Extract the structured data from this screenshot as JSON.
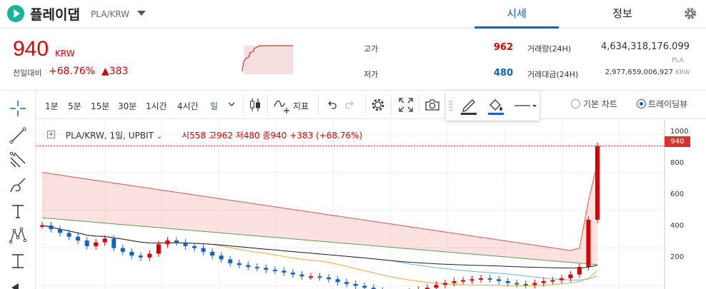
{
  "header": {
    "coin_name": "플레이댑",
    "pair": "PLA/KRW",
    "tabs": [
      {
        "label": "시세",
        "active": true
      },
      {
        "label": "정보",
        "active": false
      }
    ]
  },
  "price": {
    "value": "940",
    "unit": "KRW",
    "change_label": "전일대비",
    "change_pct": "+68.76%",
    "change_abs": "▲383"
  },
  "stats": {
    "high_label": "고가",
    "high_value": "962",
    "low_label": "저가",
    "low_value": "480",
    "volume_label": "거래량(24H)",
    "volume_value": "4,634,318,176.099",
    "volume_unit": "PLA",
    "amount_label": "거래대금(24H)",
    "amount_value": "2,977,659,006,927",
    "amount_unit": "KRW"
  },
  "toolbar": {
    "intervals": [
      {
        "label": "1분",
        "active": false
      },
      {
        "label": "5분",
        "active": false
      },
      {
        "label": "15분",
        "active": false
      },
      {
        "label": "30분",
        "active": false
      },
      {
        "label": "1시간",
        "active": false
      },
      {
        "label": "4시간",
        "active": false
      },
      {
        "label": "일",
        "active": true
      }
    ],
    "indicator_label": "지표",
    "chart_modes": [
      {
        "label": "기본 차트",
        "selected": false
      },
      {
        "label": "트레이딩뷰",
        "selected": true
      }
    ]
  },
  "legend": {
    "symbol": "PLA/KRW, 1일, UPBIT",
    "open_label": "시",
    "open": "558",
    "high_label": "고",
    "high": "962",
    "low_label": "저",
    "low": "480",
    "close_label": "종",
    "close": "940",
    "change": "+383 (+68.76%)"
  },
  "colors": {
    "up": "#d60000",
    "down": "#1261c4",
    "accent": "#1261c4",
    "brand": "#1ab394"
  },
  "chart_data": {
    "type": "candlestick",
    "last_price_tag": "940",
    "y_ticks": [
      200,
      400,
      600,
      800,
      1000
    ],
    "ylim": [
      70,
      1010
    ],
    "candles_close": [
      520,
      500,
      480,
      460,
      440,
      410,
      430,
      450,
      400,
      380,
      360,
      350,
      370,
      420,
      440,
      430,
      410,
      400,
      380,
      360,
      340,
      320,
      310,
      300,
      295,
      285,
      280,
      270,
      260,
      250,
      250,
      245,
      235,
      220,
      210,
      200,
      190,
      175,
      160,
      150,
      160,
      170,
      180,
      190,
      205,
      215,
      225,
      230,
      235,
      240,
      235,
      225,
      215,
      210,
      205,
      215,
      225,
      230,
      240,
      260,
      300,
      550,
      940
    ]
  }
}
